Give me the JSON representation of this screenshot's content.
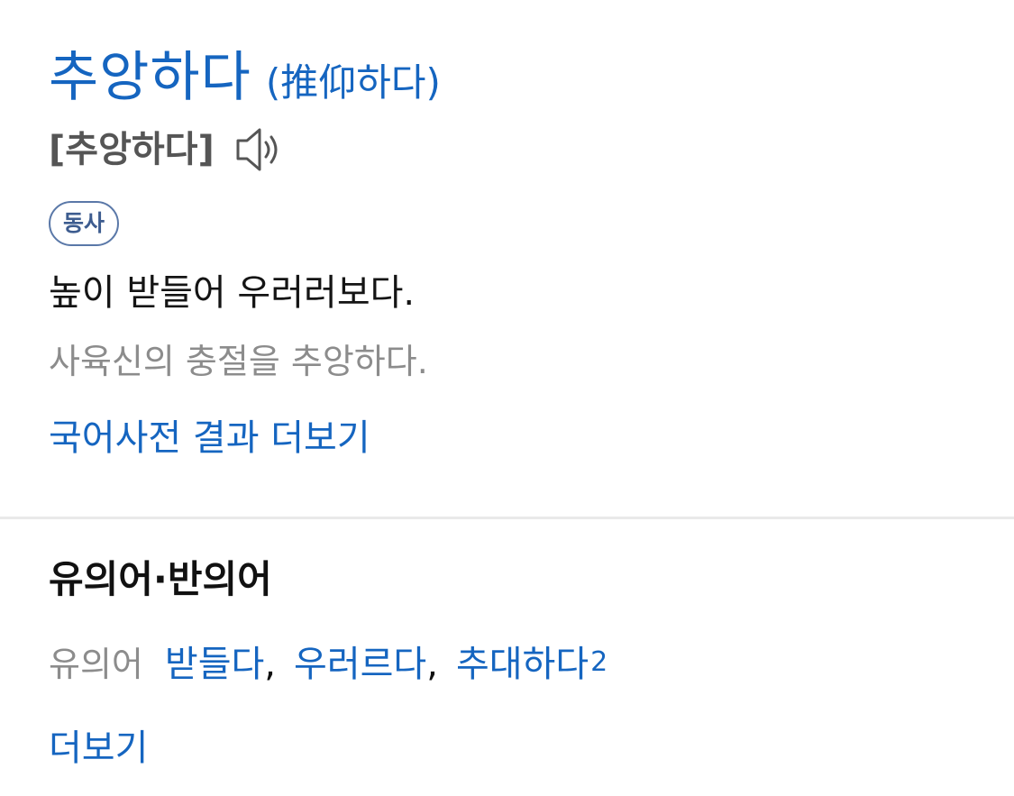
{
  "entry": {
    "headword": "추앙하다",
    "hanja": "(推仰하다)",
    "pronunciation": "[추앙하다]",
    "speaker_icon": "speaker-icon",
    "part_of_speech": "동사",
    "definition": "높이 받들어 우러러보다.",
    "example": "사육신의 충절을 추앙하다.",
    "more_link": "국어사전 결과 더보기"
  },
  "synonyms_section": {
    "title": "유의어·반의어",
    "synonym_label": "유의어",
    "synonyms": [
      {
        "word": "받들다",
        "sup": ""
      },
      {
        "word": "우러르다",
        "sup": ""
      },
      {
        "word": "추대하다",
        "sup": "2"
      }
    ],
    "separator": ",",
    "more_link": "더보기"
  },
  "colors": {
    "accent": "#1565c0",
    "muted_text": "#8c8c8c",
    "badge_border": "#5a78a8",
    "divider": "#e9e9e9"
  }
}
